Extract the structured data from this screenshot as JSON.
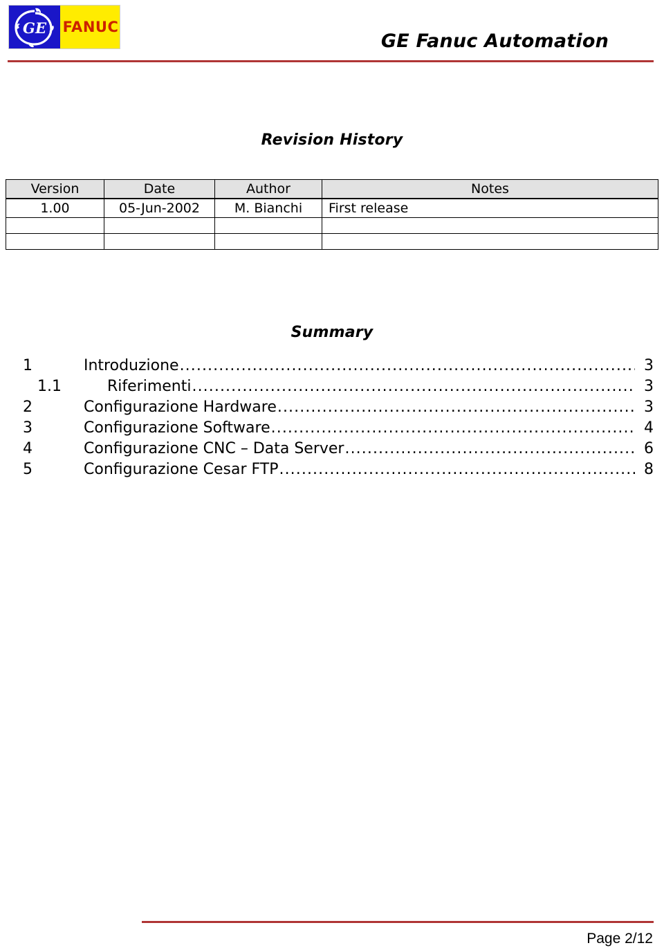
{
  "header": {
    "logo": {
      "brand_mark": "ge-monogram",
      "brand_text": "FANUC",
      "blue_hex": "#1A16C8",
      "yellow_hex": "#FFEC00",
      "red_hex": "#CC2200"
    },
    "title": "GE Fanuc Automation",
    "rule_color": "#B03535"
  },
  "revision_history": {
    "title": "Revision History",
    "columns": [
      "Version",
      "Date",
      "Author",
      "Notes"
    ],
    "rows": [
      {
        "version": "1.00",
        "date": "05-Jun-2002",
        "author": "M. Bianchi",
        "notes": "First release"
      },
      {
        "version": "",
        "date": "",
        "author": "",
        "notes": ""
      },
      {
        "version": "",
        "date": "",
        "author": "",
        "notes": ""
      }
    ]
  },
  "summary": {
    "title": "Summary",
    "entries": [
      {
        "number": "1",
        "label": "Introduzione",
        "page": "3",
        "level": 1,
        "dots": "............................................................................................"
      },
      {
        "number": "1.1",
        "label": "Riferimenti",
        "page": "3",
        "level": 2,
        "dots": "............................................................................................"
      },
      {
        "number": "2",
        "label": "Configurazione Hardware",
        "page": "3",
        "level": 1,
        "dots": "............................................................................................"
      },
      {
        "number": "3",
        "label": "Configurazione Software",
        "page": "4",
        "level": 1,
        "dots": "............................................................................................"
      },
      {
        "number": "4",
        "label": "Configurazione CNC – Data Server",
        "page": "6",
        "level": 1,
        "dots": "............................................................................................"
      },
      {
        "number": "5",
        "label": "Configurazione Cesar FTP ",
        "page": "8",
        "level": 1,
        "dots": "............................................................................................"
      }
    ]
  },
  "footer": {
    "page_label": "Page 2/12",
    "rule_color": "#B03535"
  }
}
